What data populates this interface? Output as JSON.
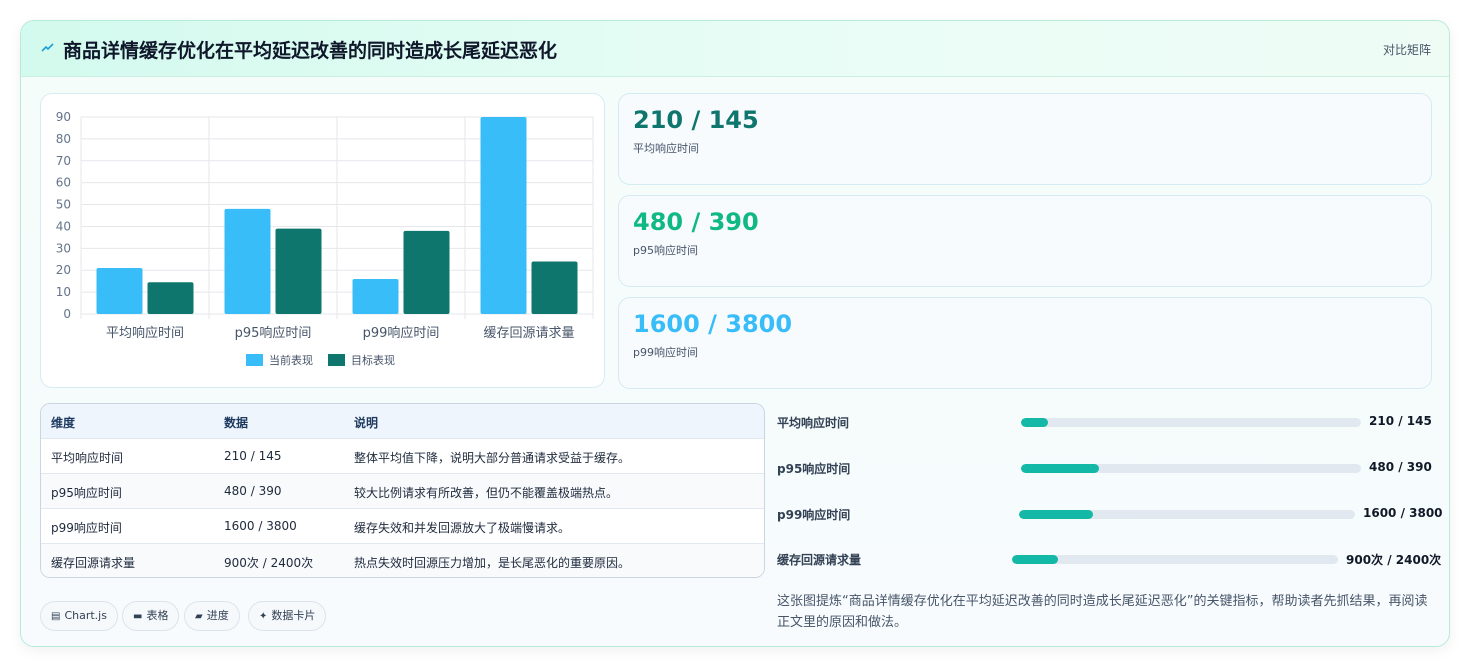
{
  "header": {
    "title": "商品详情缓存优化在平均延迟改善的同时造成长尾延迟恶化",
    "tag": "对比矩阵",
    "accent": "#1aa0d8"
  },
  "chart_data": {
    "type": "bar",
    "categories": [
      "平均响应时间",
      "p95响应时间",
      "p99响应时间",
      "缓存回源请求量"
    ],
    "series": [
      {
        "name": "当前表现",
        "values": [
          21,
          48,
          16,
          90
        ],
        "color": "#38bdf8"
      },
      {
        "name": "目标表现",
        "values": [
          14.5,
          39,
          38,
          24
        ],
        "color": "#0f766e"
      }
    ],
    "ylim": [
      0,
      90
    ],
    "yticks": [
      0,
      10,
      20,
      30,
      40,
      50,
      60,
      70,
      80,
      90
    ],
    "grid": true,
    "legend": "bottom"
  },
  "kpis": [
    {
      "value": "210 / 145",
      "label": "平均响应时间",
      "color": "#0f766e"
    },
    {
      "value": "480 / 390",
      "label": "p95响应时间",
      "color": "#10b981"
    },
    {
      "value": "1600 / 3800",
      "label": "p99响应时间",
      "color": "#38bdf8"
    }
  ],
  "table": {
    "headers": [
      "维度",
      "数据",
      "说明"
    ],
    "rows": [
      [
        "平均响应时间",
        "210 / 145",
        "整体平均值下降，说明大部分普通请求受益于缓存。"
      ],
      [
        "p95响应时间",
        "480 / 390",
        "较大比例请求有所改善，但仍不能覆盖极端热点。"
      ],
      [
        "p99响应时间",
        "1600 / 3800",
        "缓存失效和并发回源放大了极端慢请求。"
      ],
      [
        "缓存回源请求量",
        "900次 / 2400次",
        "热点失效时回源压力增加，是长尾恶化的重要原因。"
      ]
    ]
  },
  "progress": [
    {
      "label": "平均响应时间",
      "value": "210 / 145",
      "fraction": 0.08
    },
    {
      "label": "p95响应时间",
      "value": "480 / 390",
      "fraction": 0.23
    },
    {
      "label": "p99响应时间",
      "value": "1600 / 3800",
      "fraction": 0.22
    },
    {
      "label": "缓存回源请求量",
      "value": "900次 / 2400次",
      "fraction": 0.14
    }
  ],
  "note": "这张图提炼“商品详情缓存优化在平均延迟改善的同时造成长尾延迟恶化”的关键指标，帮助读者先抓结果，再阅读正文里的原因和做法。",
  "chips": [
    {
      "icon": "chart-icon",
      "glyph": "▤",
      "label": "Chart.js"
    },
    {
      "icon": "table-icon",
      "glyph": "▬",
      "label": "表格"
    },
    {
      "icon": "progress-icon",
      "glyph": "▰",
      "label": "进度"
    },
    {
      "icon": "sparkle-icon",
      "glyph": "✦",
      "label": "数据卡片"
    }
  ]
}
